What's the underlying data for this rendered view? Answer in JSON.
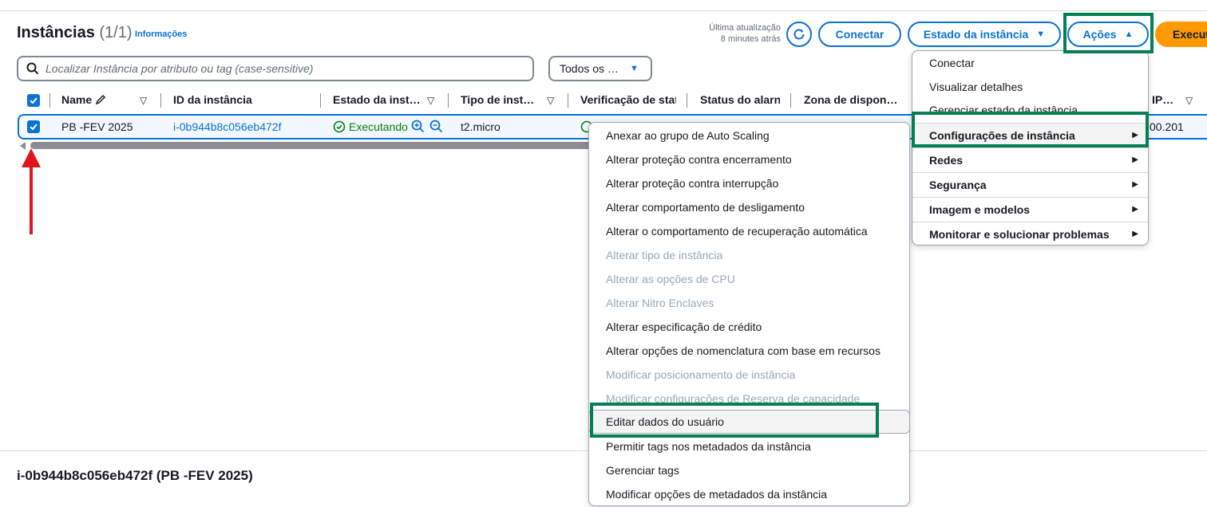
{
  "header": {
    "title": "Instâncias",
    "count": "(1/1)",
    "info_link": "Informações",
    "last_update_label": "Última atualização",
    "last_update_value": "8 minutes atrás",
    "buttons": {
      "connect": "Conectar",
      "instance_state": "Estado da instância",
      "actions": "Ações",
      "launch": "Execut"
    }
  },
  "search": {
    "placeholder": "Localizar Instância por atributo ou tag (case-sensitive)"
  },
  "filter": {
    "value": "Todos os …"
  },
  "table": {
    "columns": [
      "Name",
      "ID da instância",
      "Estado da inst…",
      "Tipo de inst…",
      "Verificação de stat",
      "Status do alarn",
      "Zona de dispon…",
      "IP…"
    ],
    "row": {
      "name": "PB -FEV 2025",
      "instance_id": "i-0b944b8c056eb472f",
      "state": "Executando",
      "type": "t2.micro",
      "ip": "00.201"
    }
  },
  "details": {
    "title": "i-0b944b8c056eb472f (PB -FEV 2025)"
  },
  "actions_menu": [
    {
      "label": "Conectar",
      "bold": false,
      "submenu": false
    },
    {
      "label": "Visualizar detalhes",
      "bold": false,
      "submenu": false
    },
    {
      "label": "Gerenciar estado da instância",
      "bold": false,
      "submenu": false
    },
    {
      "label": "Configurações de instância",
      "bold": true,
      "submenu": true
    },
    {
      "label": "Redes",
      "bold": true,
      "submenu": true
    },
    {
      "label": "Segurança",
      "bold": true,
      "submenu": true
    },
    {
      "label": "Imagem e modelos",
      "bold": true,
      "submenu": true
    },
    {
      "label": "Monitorar e solucionar problemas",
      "bold": true,
      "submenu": true
    }
  ],
  "instance_settings_menu": [
    {
      "label": "Anexar ao grupo de Auto Scaling",
      "disabled": false
    },
    {
      "label": "Alterar proteção contra encerramento",
      "disabled": false
    },
    {
      "label": "Alterar proteção contra interrupção",
      "disabled": false
    },
    {
      "label": "Alterar comportamento de desligamento",
      "disabled": false
    },
    {
      "label": "Alterar o comportamento de recuperação automática",
      "disabled": false
    },
    {
      "label": "Alterar tipo de instância",
      "disabled": true
    },
    {
      "label": "Alterar as opções de CPU",
      "disabled": true
    },
    {
      "label": "Alterar Nitro Enclaves",
      "disabled": true
    },
    {
      "label": "Alterar especificação de crédito",
      "disabled": false
    },
    {
      "label": "Alterar opções de nomenclatura com base em recursos",
      "disabled": false
    },
    {
      "label": "Modificar posicionamento de instância",
      "disabled": true
    },
    {
      "label": "Modificar configurações de Reserva de capacidade",
      "disabled": true
    },
    {
      "label": "Editar dados do usuário",
      "disabled": false
    },
    {
      "label": "Permitir tags nos metadados da instância",
      "disabled": false
    },
    {
      "label": "Gerenciar tags",
      "disabled": false
    },
    {
      "label": "Modificar opções de metadados da instância",
      "disabled": false
    }
  ],
  "colors": {
    "primary_blue": "#0972d3",
    "highlight_green": "#037f51",
    "annotation_red": "#e0161b",
    "launch_orange": "#ff9900",
    "running_green": "#037f0c"
  },
  "icons": [
    "search-icon",
    "refresh-icon",
    "edit-icon",
    "sort-icon",
    "check-circle-icon",
    "zoom-in-icon",
    "zoom-out-icon",
    "caret-right-icon",
    "caret-down-icon",
    "caret-up-icon"
  ]
}
